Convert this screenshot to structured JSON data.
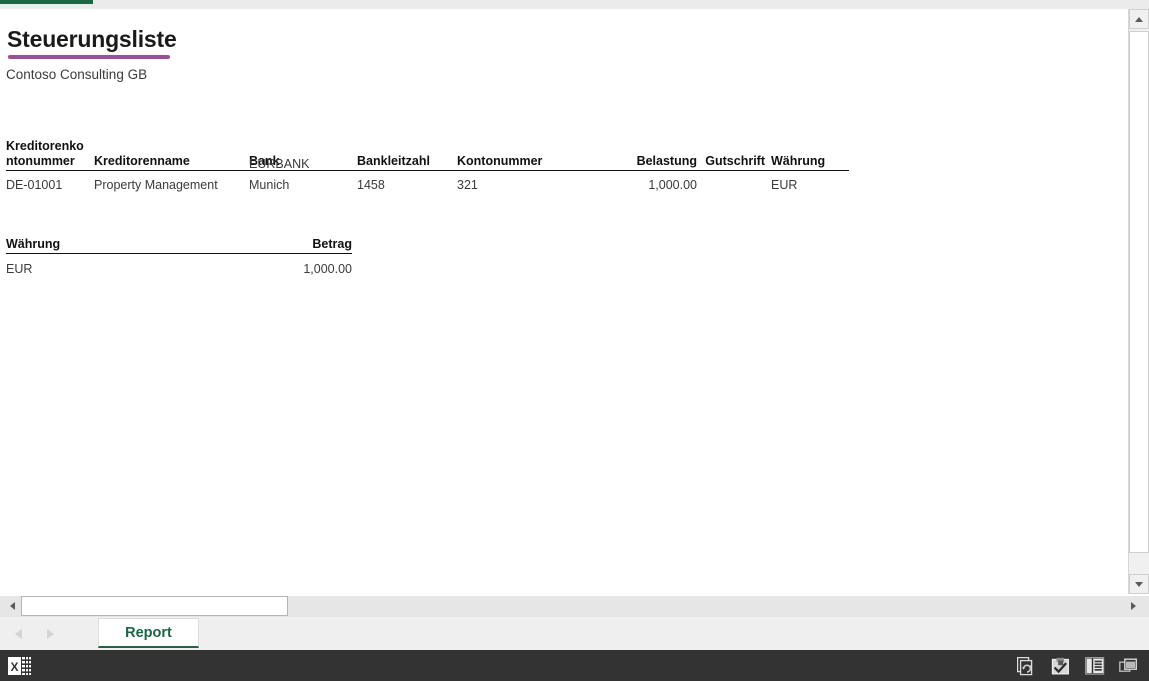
{
  "window": {
    "accent_green": "#1d6544",
    "statusbar_bg": "#333333"
  },
  "report": {
    "title": "Steuerungsliste",
    "title_rule_color": "#9b4f96",
    "subtitle": "Contoso Consulting GB"
  },
  "detail_table": {
    "columns": [
      "Kreditorenko\nntonummer",
      "Kreditorenname",
      "Bank",
      "Bankleitzahl",
      "Kontonummer",
      "Belastung",
      "Gutschrift",
      "Währung"
    ],
    "rows": [
      {
        "kreditorenkontonummer": "DE-01001",
        "kreditorenname": "Property Management",
        "bank_line1": "EURBANK",
        "bank": "Munich",
        "bankleitzahl": "1458",
        "kontonummer": "321",
        "belastung": "1,000.00",
        "gutschrift": "",
        "waehrung": "EUR"
      }
    ]
  },
  "summary_table": {
    "columns": [
      "Währung",
      "Betrag"
    ],
    "rows": [
      {
        "waehrung": "EUR",
        "betrag": "1,000.00"
      }
    ]
  },
  "scrollbars": {
    "vertical": {
      "up_icon": "triangle-up-icon",
      "down_icon": "triangle-down-icon"
    },
    "horizontal": {
      "left_icon": "triangle-left-icon",
      "right_icon": "triangle-right-icon"
    }
  },
  "tabbar": {
    "prev_icon": "triangle-left-icon",
    "next_icon": "triangle-right-icon",
    "tabs": [
      {
        "label": "Report",
        "active": true
      }
    ]
  },
  "statusbar": {
    "app_icon": "excel-logo-icon",
    "icons": [
      {
        "name": "refresh-pages-icon",
        "title": "Refresh"
      },
      {
        "name": "clipboard-check-icon",
        "title": "Checked out"
      },
      {
        "name": "reading-view-icon",
        "title": "Reading view"
      },
      {
        "name": "restore-window-icon",
        "title": "Restore window"
      }
    ]
  }
}
